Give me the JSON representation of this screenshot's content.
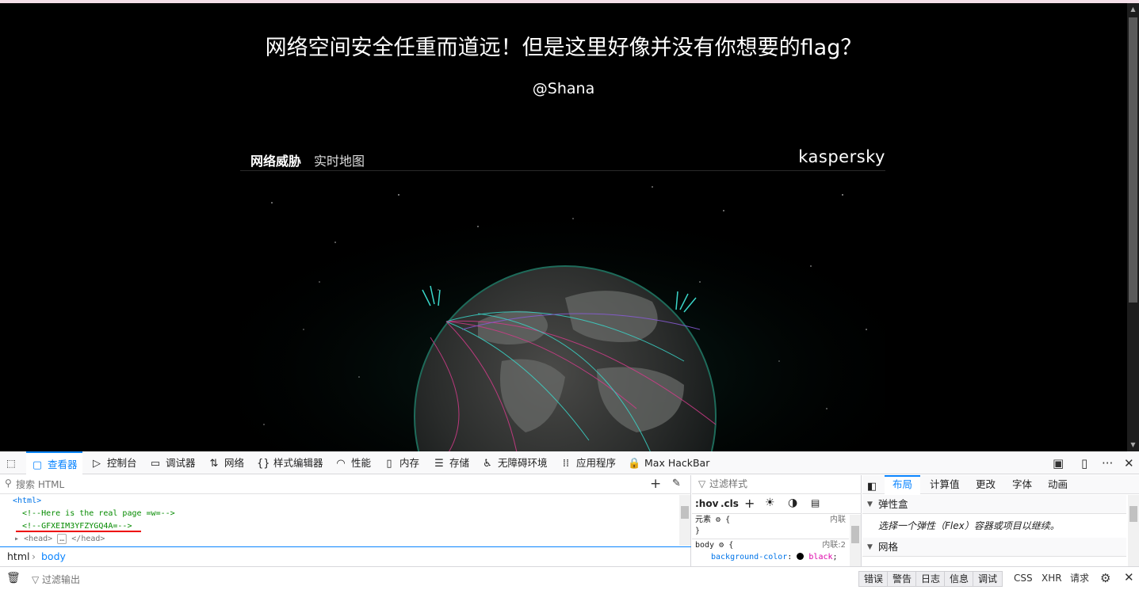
{
  "page": {
    "headline": "网络空间安全任重而道远！但是这里好像并没有你想要的flag？",
    "author": "@Shana",
    "map_title_bold": "网络威胁",
    "map_title": "实时地图",
    "map_logo": "kaspersky"
  },
  "devtools": {
    "tabs": [
      {
        "label": "查看器",
        "icon": "inspector-icon"
      },
      {
        "label": "控制台",
        "icon": "console-icon"
      },
      {
        "label": "调试器",
        "icon": "debugger-icon"
      },
      {
        "label": "网络",
        "icon": "network-icon"
      },
      {
        "label": "样式编辑器",
        "icon": "style-editor-icon"
      },
      {
        "label": "性能",
        "icon": "performance-icon"
      },
      {
        "label": "内存",
        "icon": "memory-icon"
      },
      {
        "label": "存储",
        "icon": "storage-icon"
      },
      {
        "label": "无障碍环境",
        "icon": "accessibility-icon"
      },
      {
        "label": "应用程序",
        "icon": "application-icon"
      },
      {
        "label": "Max HackBar",
        "icon": "hackbar-icon"
      }
    ],
    "search_placeholder": "搜索 HTML",
    "tree": {
      "html_open": "<html>",
      "comment1": "<!--Here is the real page =w=-->",
      "comment2": "<!--GFXEIM3YFZYGQ4A=-->",
      "head_open": "<head>",
      "head_ellipsis": "…",
      "head_close": "</head>"
    },
    "breadcrumbs": [
      "html",
      "body"
    ],
    "styles": {
      "filter_placeholder": "过滤样式",
      "hov": ":hov",
      "cls": ".cls",
      "rule1_selector": "元素",
      "rule1_brace": "{",
      "rule1_close": "}",
      "rule1_source": "内联",
      "rule2_selector": "body",
      "rule2_brace": "{",
      "rule2_source": "内联:2",
      "rule2_prop": "background-color",
      "rule2_value": "black"
    },
    "layout": {
      "tabs": [
        "布局",
        "计算值",
        "更改",
        "字体",
        "动画"
      ],
      "flex_section": "弹性盒",
      "flex_note": "选择一个弹性（Flex）容器或项目以继续。",
      "grid_section": "网格"
    },
    "console": {
      "filter_placeholder": "过滤输出",
      "filters": [
        "错误",
        "警告",
        "日志",
        "信息",
        "调试",
        "CSS",
        "XHR",
        "请求"
      ]
    }
  }
}
